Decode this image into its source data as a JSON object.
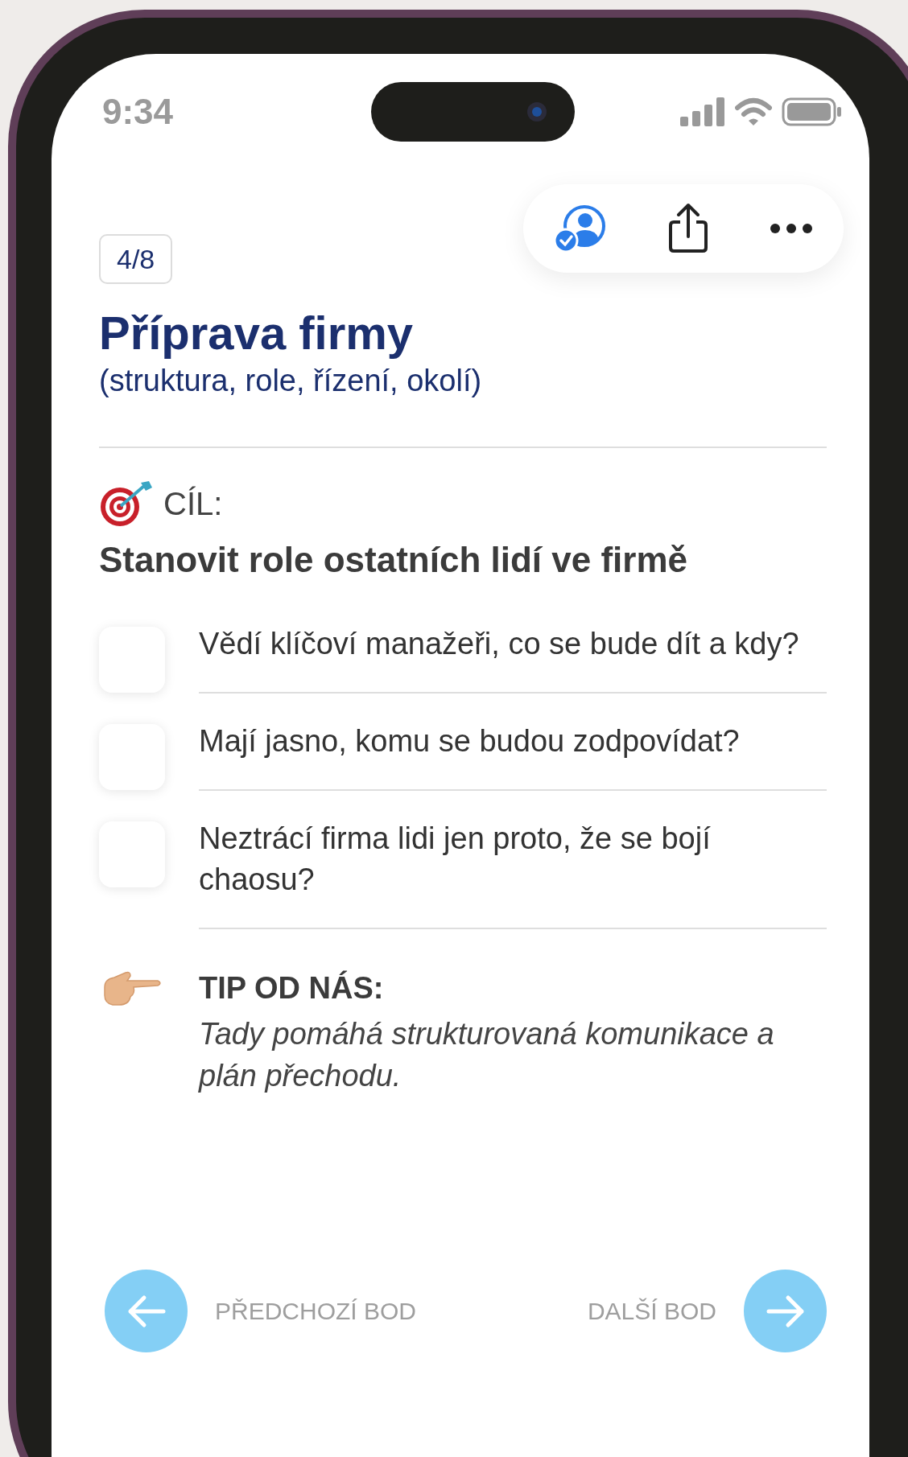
{
  "status_bar": {
    "time": "9:34"
  },
  "progress_badge": "4/8",
  "title": "Příprava firmy",
  "subtitle": "(struktura, role, řízení, okolí)",
  "goal": {
    "label": "CÍL:",
    "heading": "Stanovit role ostatních lidí ve firmě"
  },
  "checklist": [
    {
      "text": "Vědí klíčoví manažeři, co se bude dít a kdy?",
      "checked": false
    },
    {
      "text": "Mají jasno, komu se budou zodpovídat?",
      "checked": false
    },
    {
      "text": "Neztrácí firma lidi jen proto, že se bojí chaosu?",
      "checked": false
    }
  ],
  "tip": {
    "heading": "TIP OD NÁS:",
    "text": "Tady pomáhá strukturovaná komunikace a plán přechodu."
  },
  "nav": {
    "previous": "PŘEDCHOZÍ BOD",
    "next": "DALŠÍ BOD"
  }
}
